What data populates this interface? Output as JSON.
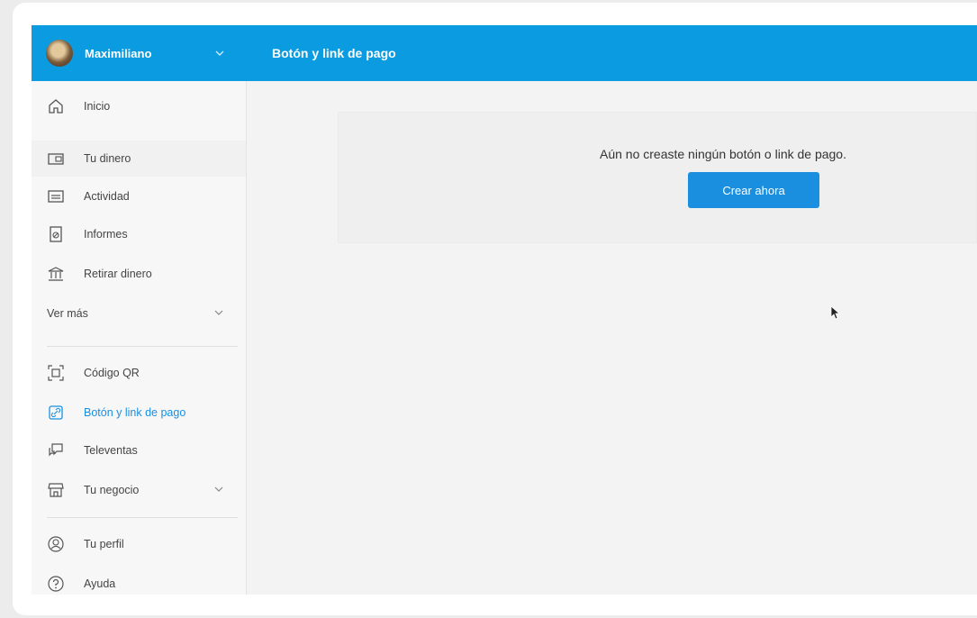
{
  "user": {
    "name": "Maximiliano"
  },
  "header": {
    "title": "Botón y link de pago"
  },
  "sidebar": {
    "items": [
      {
        "label": "Inicio",
        "icon": "home-icon"
      },
      {
        "label": "Tu dinero",
        "icon": "wallet-icon"
      },
      {
        "label": "Actividad",
        "icon": "activity-icon"
      },
      {
        "label": "Informes",
        "icon": "reports-icon"
      },
      {
        "label": "Retirar dinero",
        "icon": "bank-icon"
      },
      {
        "label": "Ver más",
        "icon": "chevron-down-icon"
      },
      {
        "label": "Código QR",
        "icon": "qr-icon"
      },
      {
        "label": "Botón y link de pago",
        "icon": "link-icon",
        "active": true
      },
      {
        "label": "Televentas",
        "icon": "chat-icon"
      },
      {
        "label": "Tu negocio",
        "icon": "store-icon"
      },
      {
        "label": "Tu perfil",
        "icon": "profile-icon"
      },
      {
        "label": "Ayuda",
        "icon": "help-icon"
      }
    ]
  },
  "main": {
    "empty_message": "Aún no creaste ningún botón o link de pago.",
    "create_button": "Crear ahora"
  },
  "colors": {
    "brand": "#0a9be0",
    "accent": "#1a8fe0"
  }
}
